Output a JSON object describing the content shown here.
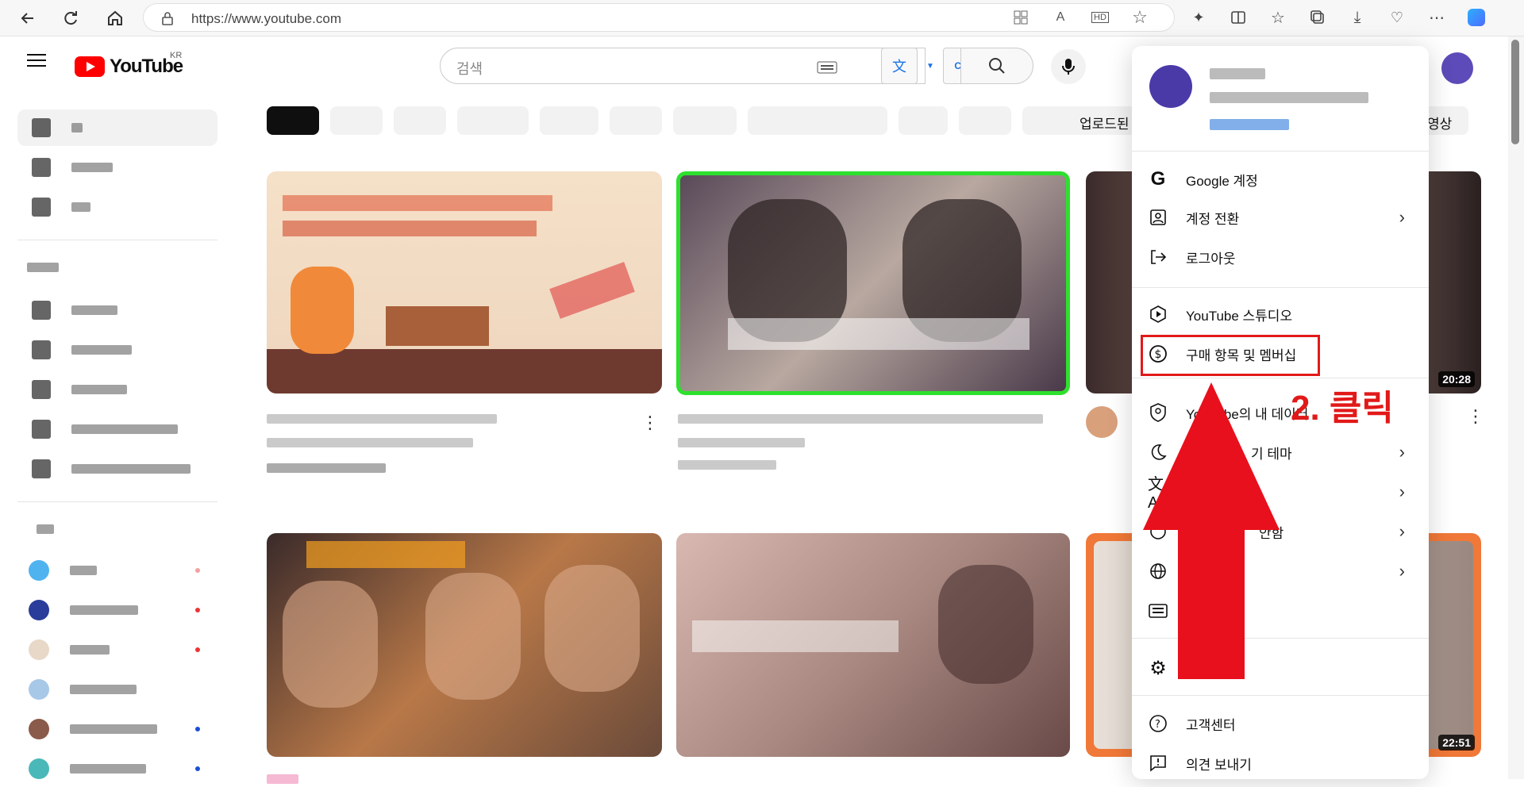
{
  "browser": {
    "url": "https://www.youtube.com"
  },
  "header": {
    "logo_text": "YouTube",
    "region": "KR",
    "search_placeholder": "검색"
  },
  "chips": [
    {
      "label": "",
      "active": true
    },
    {
      "label": "",
      "active": false
    },
    {
      "label": "",
      "active": false
    },
    {
      "label": "",
      "active": false
    },
    {
      "label": "",
      "active": false
    },
    {
      "label": "",
      "active": false
    },
    {
      "label": "",
      "active": false
    },
    {
      "label": "",
      "active": false
    },
    {
      "label": "",
      "active": false
    },
    {
      "label": "",
      "active": false
    },
    {
      "label": "업로드된",
      "active": false
    },
    {
      "label": "영상",
      "active": false
    }
  ],
  "videos": {
    "row1": [
      {
        "duration": ""
      },
      {
        "duration": ""
      },
      {
        "duration": "20:28"
      }
    ],
    "row2": [
      {
        "duration": ""
      },
      {
        "duration": ""
      },
      {
        "duration": "22:51"
      }
    ]
  },
  "account_menu": {
    "items_group1": [
      {
        "label": "Google 계정",
        "icon": "google-icon",
        "chevron": false
      },
      {
        "label": "계정 전환",
        "icon": "switch-account-icon",
        "chevron": true
      },
      {
        "label": "로그아웃",
        "icon": "sign-out-icon",
        "chevron": false
      }
    ],
    "items_group2": [
      {
        "label": "YouTube 스튜디오",
        "icon": "studio-icon",
        "chevron": false
      },
      {
        "label": "구매 항목 및 멤버십",
        "icon": "dollar-icon",
        "chevron": false
      }
    ],
    "items_group3": [
      {
        "label": "YouTube의 내 데이터",
        "icon": "shield-icon",
        "chevron": false
      },
      {
        "label": "기 테마",
        "icon": "moon-icon",
        "chevron": true
      },
      {
        "label": "",
        "icon": "translate-icon",
        "chevron": true
      },
      {
        "label": "안함",
        "icon": "restricted-icon",
        "chevron": true
      },
      {
        "label": "",
        "icon": "globe-icon",
        "chevron": true
      },
      {
        "label": "",
        "icon": "keyboard-icon",
        "chevron": false
      }
    ],
    "items_group4": [
      {
        "label": "",
        "icon": "gear-icon",
        "chevron": false
      }
    ],
    "items_group5": [
      {
        "label": "고객센터",
        "icon": "help-icon",
        "chevron": false
      },
      {
        "label": "의견 보내기",
        "icon": "feedback-icon",
        "chevron": false
      }
    ]
  },
  "annotation": {
    "text": "2. 클릭",
    "color": "#e21919"
  }
}
